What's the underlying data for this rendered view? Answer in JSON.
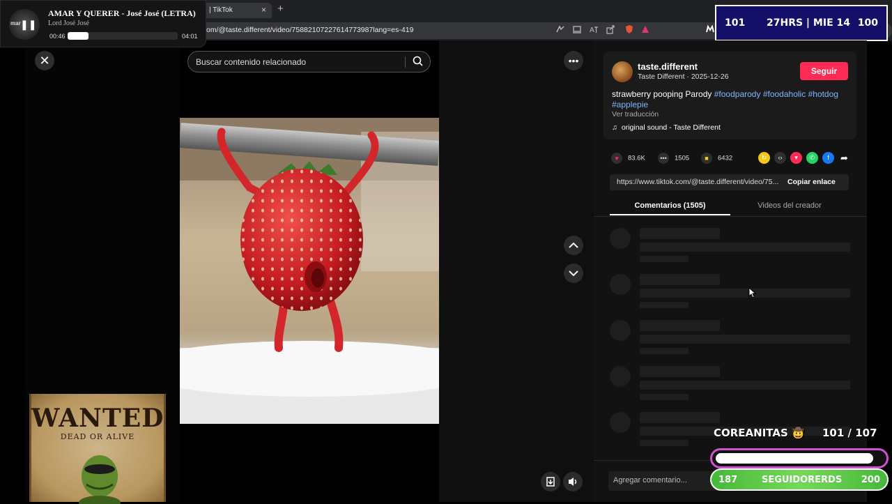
{
  "browser": {
    "tab_title": "| TikTok",
    "tab_close": "×",
    "new_tab": "+",
    "url": "om/@taste.different/video/75882107227614773987lang=es-419"
  },
  "media_player": {
    "title": "AMAR Y QUERER - José José (LETRA)",
    "artist": "Lord José José",
    "thumb_text": "mar",
    "current_time": "00:46",
    "duration": "04:01",
    "progress": 0.19,
    "pause_icon": "❚❚"
  },
  "stream_counter": {
    "left": "101",
    "middle": "27HRS | MIE 14",
    "right": "100"
  },
  "viewer": {
    "close_icon": "✕",
    "search_placeholder": "Buscar contenido relacionado",
    "more_icon": "•••",
    "up_icon": "⌃",
    "down_icon": "⌄"
  },
  "post": {
    "username": "taste.different",
    "nickname_date": "Taste Different · 2025-12-26",
    "follow_label": "Seguir",
    "description_text": "strawberry pooping Parody ",
    "hashtags": [
      "#foodparody",
      "#foodaholic",
      "#hotdog",
      "#applepie"
    ],
    "translate_label": "Ver traducción",
    "sound": "original sound - Taste Different",
    "likes": "83.6K",
    "comments": "1505",
    "saves": "6432",
    "link": "https://www.tiktok.com/@taste.different/video/75...",
    "copy_label": "Copiar enlace",
    "tab_comments": "Comentarios (1505)",
    "tab_creator": "Videos del creador",
    "comment_placeholder": "Agregar comentario..."
  },
  "poster": {
    "title": "WANTED",
    "subtitle": "DEAD OR ALIVE"
  },
  "goal": {
    "name": "COREANITAS",
    "count": "101  / 107",
    "progress": 0.94,
    "follower_min": "187",
    "follower_label": "SEGUIDORERDS",
    "follower_max": "200"
  },
  "colors": {
    "accent": "#fe2c55",
    "hashtag": "#7eb6ff",
    "counter_bg": "#14106a",
    "goal_border": "#d14fd1",
    "follower_bar": "#47b83a"
  }
}
